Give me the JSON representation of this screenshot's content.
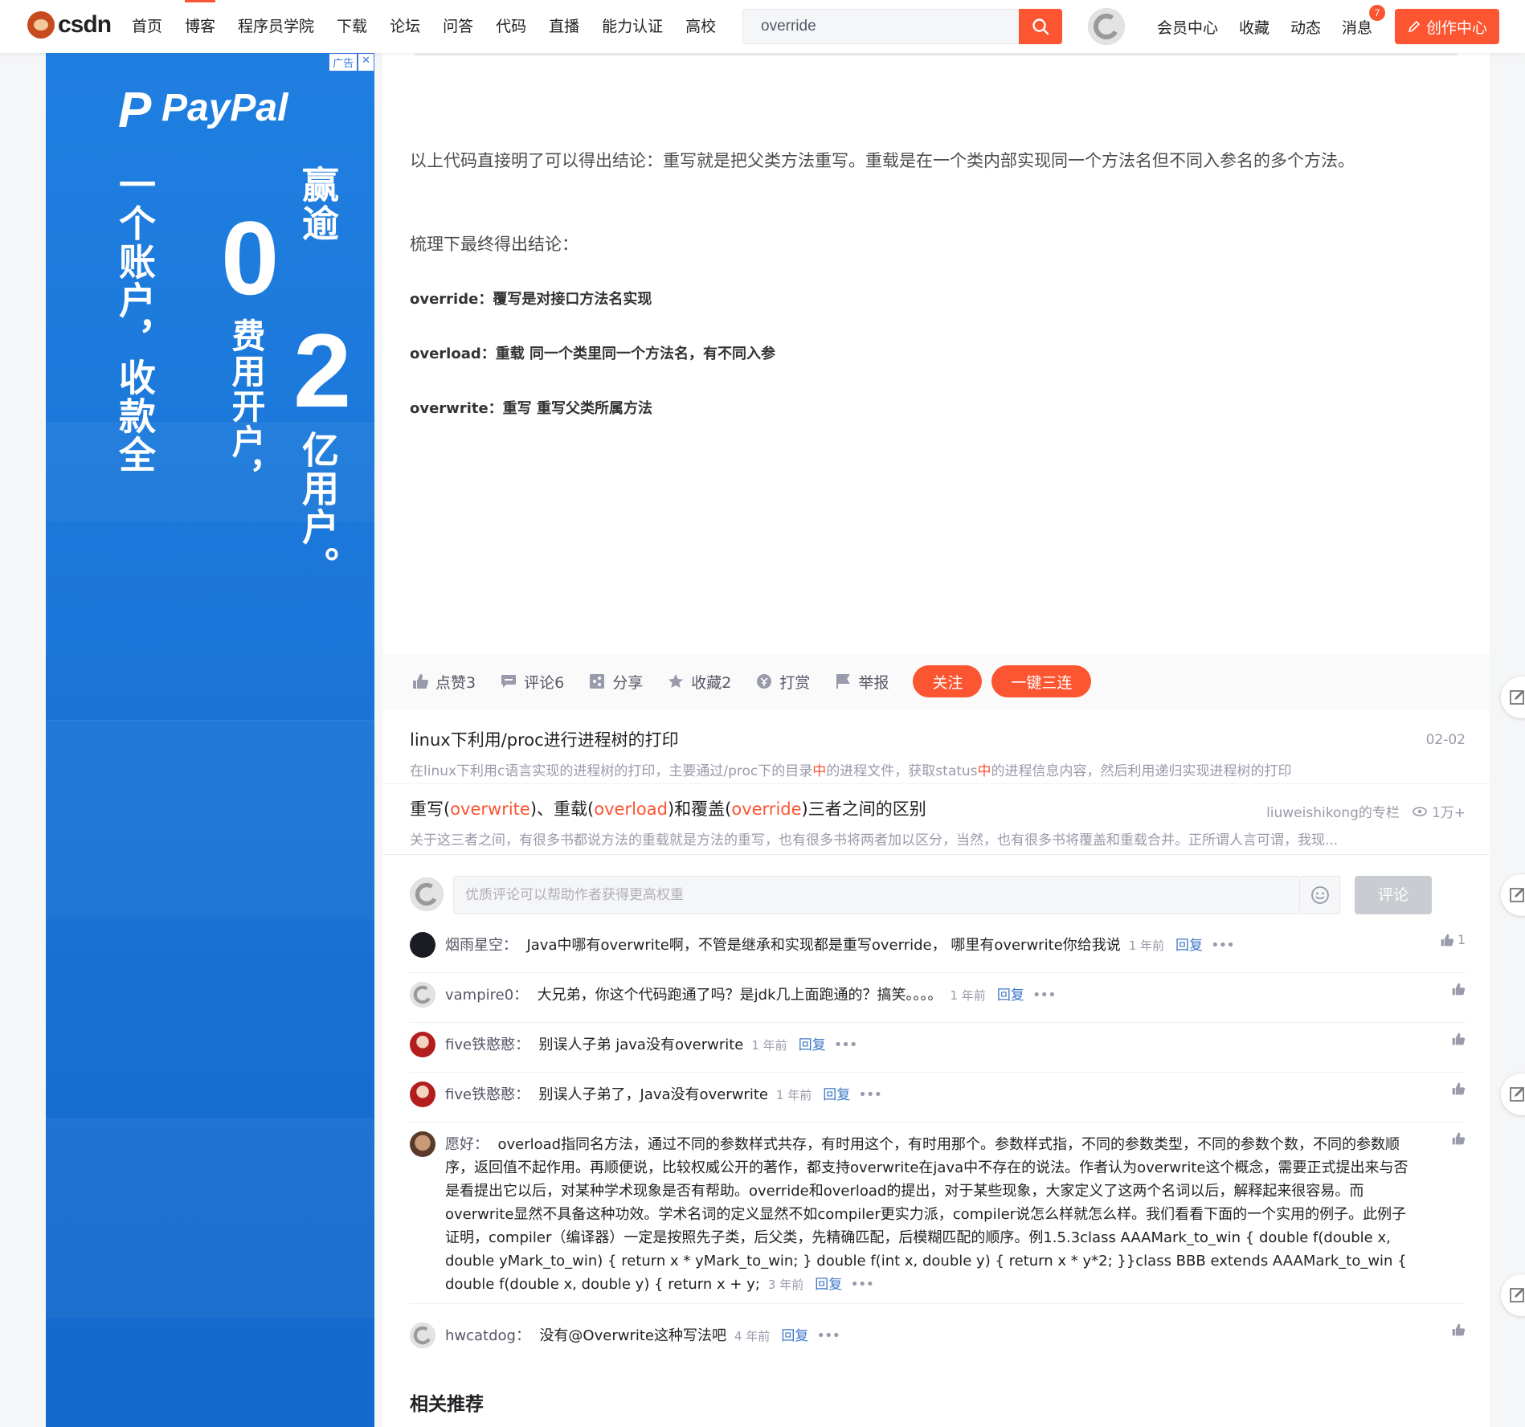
{
  "nav": {
    "logo_text": "csdn",
    "items": [
      "首页",
      "博客",
      "程序员学院",
      "下载",
      "论坛",
      "问答",
      "代码",
      "直播",
      "能力认证",
      "高校"
    ],
    "active_index": 1,
    "search_value": "override",
    "right_items": [
      "会员中心",
      "收藏",
      "动态",
      "消息"
    ],
    "message_count": "7",
    "create_label": "创作中心"
  },
  "ad": {
    "tag": "广告",
    "brand": "PayPal",
    "col1": "一个账户，收款全",
    "big0": "0",
    "col2": "费用开户，",
    "col3_top": "赢逾",
    "big2": "2",
    "col3": "亿用户。",
    "bg_color": "#1f7fe0"
  },
  "article": {
    "conclusion": "以上代码直接明了可以得出结论：重写就是把父类方法重写。重载是在一个类内部实现同一个方法名但不同入参名的多个方法。",
    "summary_title": "梳理下最终得出结论：",
    "override_line": "override：覆写是对接口方法名实现",
    "overload_line": "overload：重载 同一个类里同一个方法名，有不同入参",
    "overwrite_line": "overwrite：重写 重写父类所属方法"
  },
  "toolbar": {
    "like": "点赞3",
    "comment": "评论6",
    "share": "分享",
    "collect": "收藏2",
    "reward": "打赏",
    "report": "举报",
    "follow": "关注",
    "triple": "一键三连"
  },
  "recs": [
    {
      "title": "linux下利用/proc进行进程树的打印",
      "desc_a": "在linux下利用c语言实现的进程树的打印，主要通过/proc下的目录",
      "desc_hl1": "中",
      "desc_b": "的进程文件，获取status",
      "desc_hl2": "中",
      "desc_c": "的进程信息内容，然后利用递归实现进程树的打印",
      "date": "02-02"
    },
    {
      "title_a": "重写(",
      "title_hl1": "overwrite",
      "title_b": ")、重载(",
      "title_hl2": "overload",
      "title_c": ")和覆盖(",
      "title_hl3": "override",
      "title_d": ")三者之间的区别",
      "desc": "关于这三者之间，有很多书都说方法的重载就是方法的重写，也有很多书将两者加以区分，当然，也有很多书将覆盖和重载合并。正所谓人言可谓，我现...",
      "author": "liuweishikong的专栏",
      "views": "1万+"
    }
  ],
  "comment_box": {
    "placeholder": "优质评论可以帮助作者获得更高权重",
    "submit": "评论"
  },
  "comments": [
    {
      "name": "烟雨星空：",
      "text": "Java中哪有overwrite啊，不管是继承和实现都是重写override， 哪里有overwrite你给我说",
      "time": "1 年前",
      "reply": "回复",
      "likes": "1"
    },
    {
      "name": "vampire0：",
      "text": "大兄弟，你这个代码跑通了吗？是jdk几上面跑通的？搞笑。。。。",
      "time": "1 年前",
      "reply": "回复",
      "likes": ""
    },
    {
      "name": "five铁憨憨：",
      "text": "别误人子弟 java没有overwrite",
      "time": "1 年前",
      "reply": "回复",
      "likes": ""
    },
    {
      "name": "five铁憨憨：",
      "text": "别误人子弟了，Java没有overwrite",
      "time": "1 年前",
      "reply": "回复",
      "likes": ""
    },
    {
      "name": "愿好：",
      "text": "overload指同名方法，通过不同的参数样式共存，有时用这个，有时用那个。参数样式指，不同的参数类型，不同的参数个数，不同的参数顺序，返回值不起作用。再顺便说，比较权威公开的著作，都支持overwrite在java中不存在的说法。作者认为overwrite这个概念，需要正式提出来与否是看提出它以后，对某种学术现象是否有帮助。override和overload的提出，对于某些现象，大家定义了这两个名词以后，解释起来很容易。而overwrite显然不具备这种功效。学术名词的定义显然不如compiler更实力派，compiler说怎么样就怎么样。我们看看下面的一个实用的例子。此例子证明，compiler（编译器）一定是按照先子类，后父类，先精确匹配，后模糊匹配的顺序。例1.5.3class AAAMark_to_win { double f(double x, double yMark_to_win) { return x * yMark_to_win; } double f(int x, double y) { return x * y*2; }}class BBB extends AAAMark_to_win { double f(double x, double y) { return x + y;",
      "time": "3 年前",
      "reply": "回复",
      "likes": ""
    },
    {
      "name": "hwcatdog：",
      "text": "没有@Overwrite这种写法吧",
      "time": "4 年前",
      "reply": "回复",
      "likes": ""
    }
  ],
  "related_title": "相关推荐",
  "colors": {
    "accent": "#fc5531",
    "link": "#3d78c8",
    "muted": "#999aaa"
  }
}
